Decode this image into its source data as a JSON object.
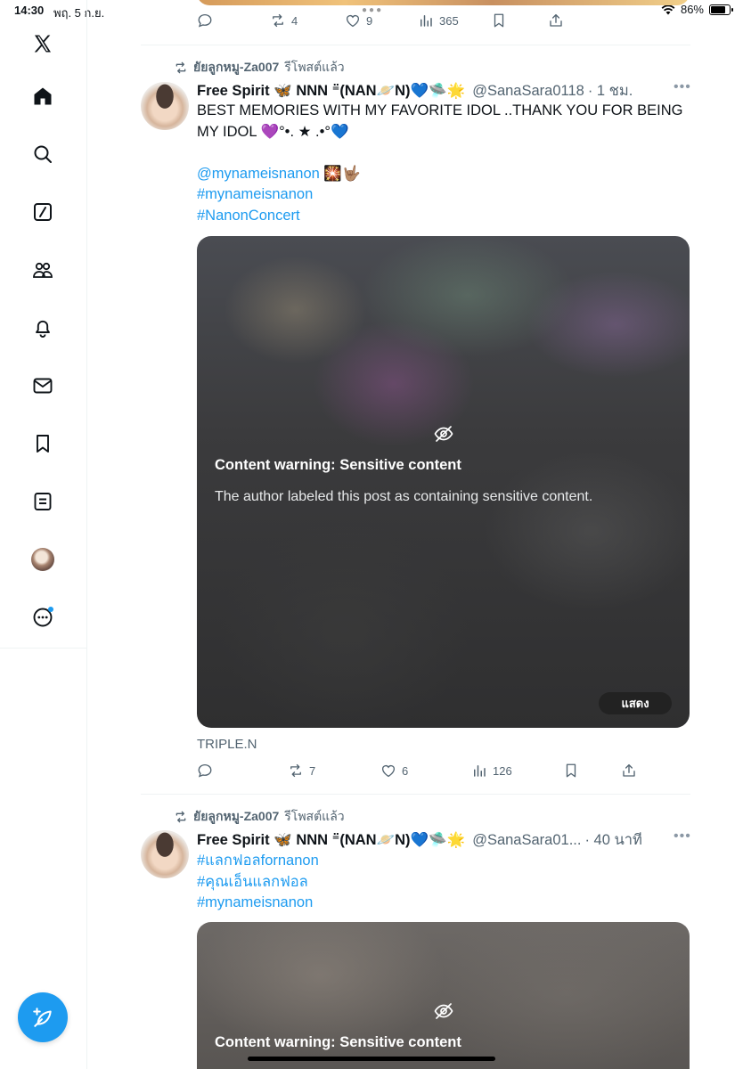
{
  "status_bar": {
    "time": "14:30",
    "date": "พฤ. 5 ก.ย.",
    "battery_percent": "86%",
    "battery_level": 0.86
  },
  "sidebar": {
    "items": [
      {
        "name": "x-logo-icon"
      },
      {
        "name": "home-icon"
      },
      {
        "name": "search-icon"
      },
      {
        "name": "grok-icon"
      },
      {
        "name": "communities-icon"
      },
      {
        "name": "notifications-icon"
      },
      {
        "name": "messages-icon"
      },
      {
        "name": "bookmarks-icon"
      },
      {
        "name": "lists-icon"
      },
      {
        "name": "profile-avatar"
      },
      {
        "name": "more-icon"
      }
    ],
    "accent_color": "#1d9bf0"
  },
  "top_post_actions": {
    "replies": "",
    "reposts": "4",
    "likes": "9",
    "views": "365"
  },
  "posts": [
    {
      "repost_by": "ยัยลูกหมู-Za007",
      "repost_label": "รีโพสต์แล้ว",
      "author_name": "Free Spirit 🦋 NNN ⁼̈(NAN🪐N)💙🛸🌟",
      "handle": "@SanaSara0118",
      "time": "· 1 ชม.",
      "text": "BEST MEMORIES WITH MY FAVORITE IDOL ..THANK YOU FOR BEING MY IDOL 💜°•. ★ .•°💙",
      "mention": "@mynameisnanon 🎇🤟🏽",
      "hashtags": [
        "#mynameisnanon",
        "#NanonConcert"
      ],
      "media": {
        "warning_title": "Content warning: Sensitive content",
        "warning_desc": "The author labeled this post as containing sensitive content.",
        "show_label": "แสดง"
      },
      "caption": "TRIPLE.N",
      "actions": {
        "replies": "",
        "reposts": "7",
        "likes": "6",
        "views": "126"
      }
    },
    {
      "repost_by": "ยัยลูกหมู-Za007",
      "repost_label": "รีโพสต์แล้ว",
      "author_name": "Free Spirit 🦋 NNN ⁼̈(NAN🪐N)💙🛸🌟",
      "handle": "@SanaSara01...",
      "time": "· 40 นาที",
      "hashtags": [
        "#แลกฟอลfornanon",
        "#คุณเอ็นแลกฟอล",
        "#mynameisnanon"
      ],
      "media": {
        "warning_title": "Content warning: Sensitive content"
      }
    }
  ]
}
